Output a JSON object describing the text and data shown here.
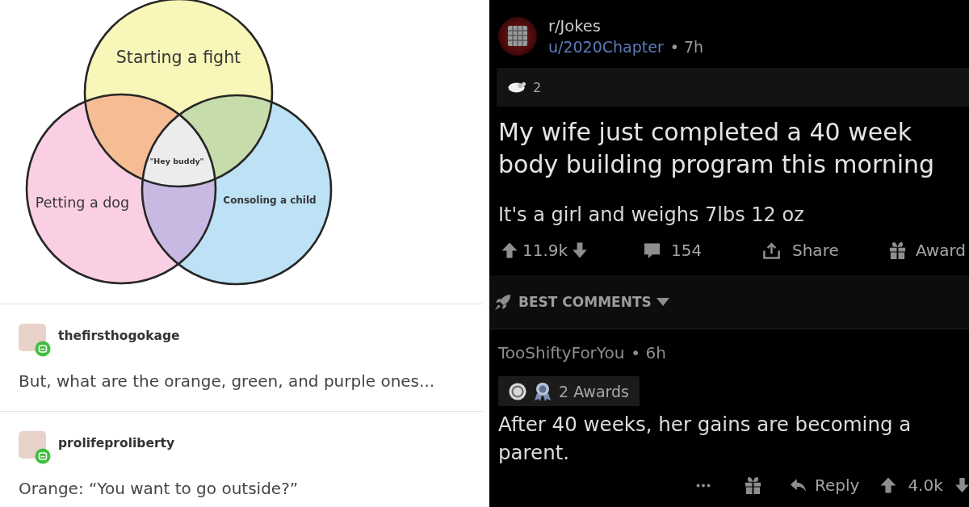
{
  "left_post": {
    "venn_diagram": {
      "sets": [
        {
          "label": "Starting a fight",
          "color": "#f9f6b9"
        },
        {
          "label": "Petting a dog",
          "color": "#fbcfe3"
        },
        {
          "label": "Consoling a child",
          "color": "#bee2f5"
        }
      ],
      "overlaps": [
        {
          "color": "#f6bd95"
        },
        {
          "color": "#c6dcab"
        },
        {
          "color": "#c7b9e1"
        }
      ],
      "center": {
        "label": "\"Hey buddy\"",
        "color": "#ececec"
      }
    },
    "replies": [
      {
        "username": "thefirsthogokage",
        "text": "But, what are the orange, green, and purple ones..."
      },
      {
        "username": "prolifeproliberty",
        "text": "Orange: “You want to go outside?”"
      }
    ]
  },
  "right_post": {
    "subreddit": "r/Jokes",
    "author": "u/2020Chapter",
    "age": "• 7h",
    "award_count": "2",
    "title": "My wife just completed a 40 week body building program this morning",
    "body": "It's a girl and weighs 7lbs 12 oz",
    "actions": [
      {
        "kind": "vote",
        "label": "11.9k"
      },
      {
        "kind": "comments",
        "label": "154"
      },
      {
        "kind": "share",
        "label": "Share"
      },
      {
        "kind": "award",
        "label": "Award"
      }
    ],
    "sort": "BEST COMMENTS",
    "comment": {
      "author": "TooShiftyForYou",
      "age": "• 6h",
      "awards": "2 Awards",
      "text": "After 40 weeks, her gains are becoming a parent.",
      "reply": "Reply",
      "score": "4.0k"
    }
  }
}
